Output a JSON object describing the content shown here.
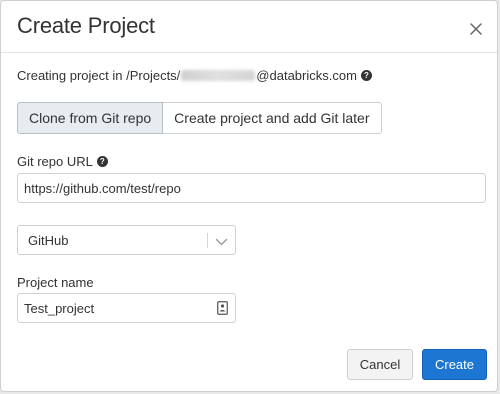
{
  "modal": {
    "title": "Create Project",
    "close_icon": "close-icon"
  },
  "path": {
    "prefix": "Creating project in /Projects/",
    "suffix": "@databricks.com",
    "help_icon": "question-circle-icon"
  },
  "mode_toggle": {
    "options": [
      {
        "label": "Clone from Git repo",
        "selected": true
      },
      {
        "label": "Create project and add Git later",
        "selected": false
      }
    ]
  },
  "git_url": {
    "label": "Git repo URL",
    "value": "https://github.com/test/repo",
    "help_icon": "question-circle-icon"
  },
  "provider": {
    "selected": "GitHub",
    "icon": "chevron-down-icon"
  },
  "project_name": {
    "label": "Project name",
    "value": "Test_project",
    "icon": "contact-card-icon"
  },
  "footer": {
    "cancel_label": "Cancel",
    "create_label": "Create"
  },
  "colors": {
    "primary": "#1d76d2",
    "selected_toggle": "#e7ecf1"
  }
}
